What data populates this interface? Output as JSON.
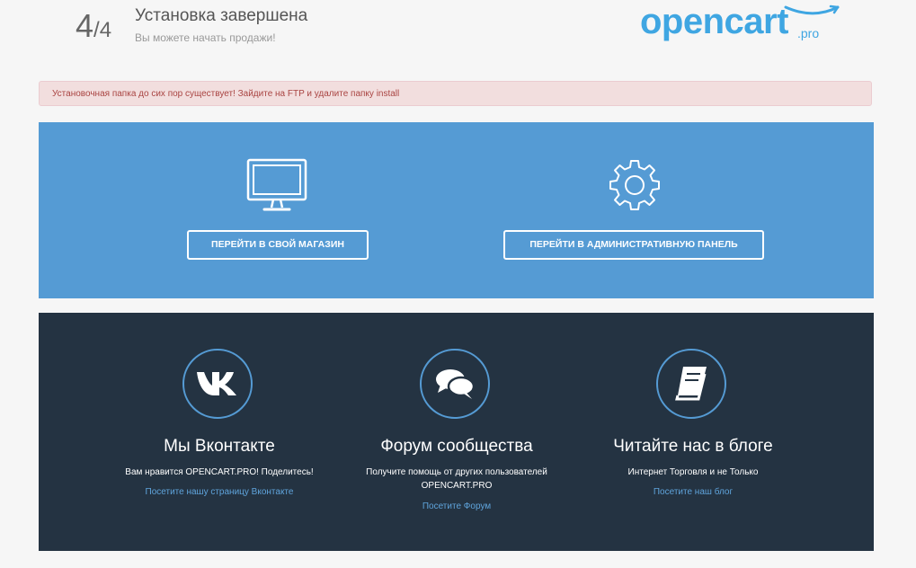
{
  "header": {
    "step_current": "4",
    "step_sep": "/",
    "step_total": "4",
    "title": "Установка завершена",
    "subtitle": "Вы можете начать продажи!"
  },
  "logo": {
    "name": "opencart",
    "suffix": ".pro",
    "color": "#3fa6e2"
  },
  "alert": {
    "text": "Установочная папка до сих пор существует! Зайдите на FTP и удалите папку install"
  },
  "actions": {
    "store_label": "ПЕРЕЙТИ В СВОЙ МАГАЗИН",
    "admin_label": "ПЕРЕЙТИ В АДМИНИСТРАТИВНУЮ ПАНЕЛЬ",
    "store_icon": "monitor-icon",
    "admin_icon": "gear-icon"
  },
  "community": [
    {
      "icon": "vk-icon",
      "title": "Мы Вконтакте",
      "desc": "Вам нравится OPENCART.PRO! Поделитесь!",
      "link": "Посетите нашу страницу Вконтакте"
    },
    {
      "icon": "chat-bubbles-icon",
      "title": "Форум сообщества",
      "desc": "Получите помощь от других пользователей OPENCART.PRO",
      "link": "Посетите Форум"
    },
    {
      "icon": "book-icon",
      "title": "Читайте нас в блоге",
      "desc": "Интернет Торговля и не Только",
      "link": "Посетите наш блог"
    }
  ],
  "colors": {
    "blue_panel": "#559bd4",
    "dark_panel": "#243342",
    "alert_bg": "#f2dede",
    "alert_text": "#a94442",
    "link": "#5fa4dc"
  }
}
